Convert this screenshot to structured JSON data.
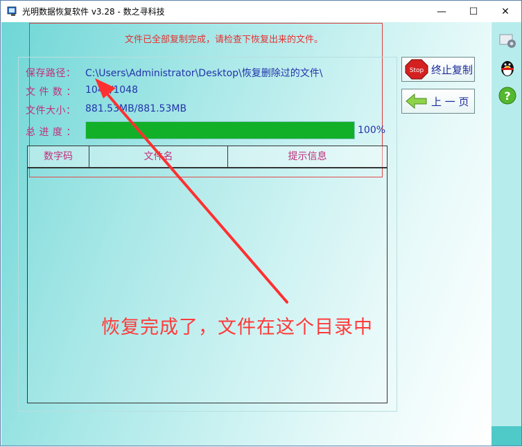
{
  "window": {
    "title": "光明数据恢复软件 v3.28 - 数之寻科技",
    "minimize_glyph": "—",
    "maximize_glyph": "☐",
    "close_glyph": "✕"
  },
  "status_message": "文件已全部复制完成，请检查下恢复出来的文件。",
  "fields": {
    "save_path_label": "保存路径：",
    "save_path_value": "C:\\Users\\Administrator\\Desktop\\恢复删除过的文件\\",
    "file_count_label": "文 件 数 ：",
    "file_count_value": "1048/1048",
    "file_size_label": "文件大小：",
    "file_size_value": "881.53MB/881.53MB",
    "progress_label": "总 进 度 ：",
    "progress_percent": 100,
    "progress_text": "100%"
  },
  "table": {
    "columns": [
      "数字码",
      "文件名",
      "提示信息"
    ],
    "rows": []
  },
  "buttons": {
    "stop_copy": "终止复制",
    "stop_icon_text": "Stop",
    "previous_page": "上 一 页"
  },
  "annotation": "恢复完成了，文件在这个目录中",
  "colors": {
    "accent_red": "#e53030",
    "label_color": "#c0307a",
    "value_color": "#2233aa",
    "progress_green": "#12b028",
    "background_teal": "#6fd6d6"
  },
  "icons": [
    "app-icon",
    "stop-icon",
    "back-arrow-icon",
    "settings-icon",
    "qq-penguin-icon",
    "help-icon"
  ]
}
